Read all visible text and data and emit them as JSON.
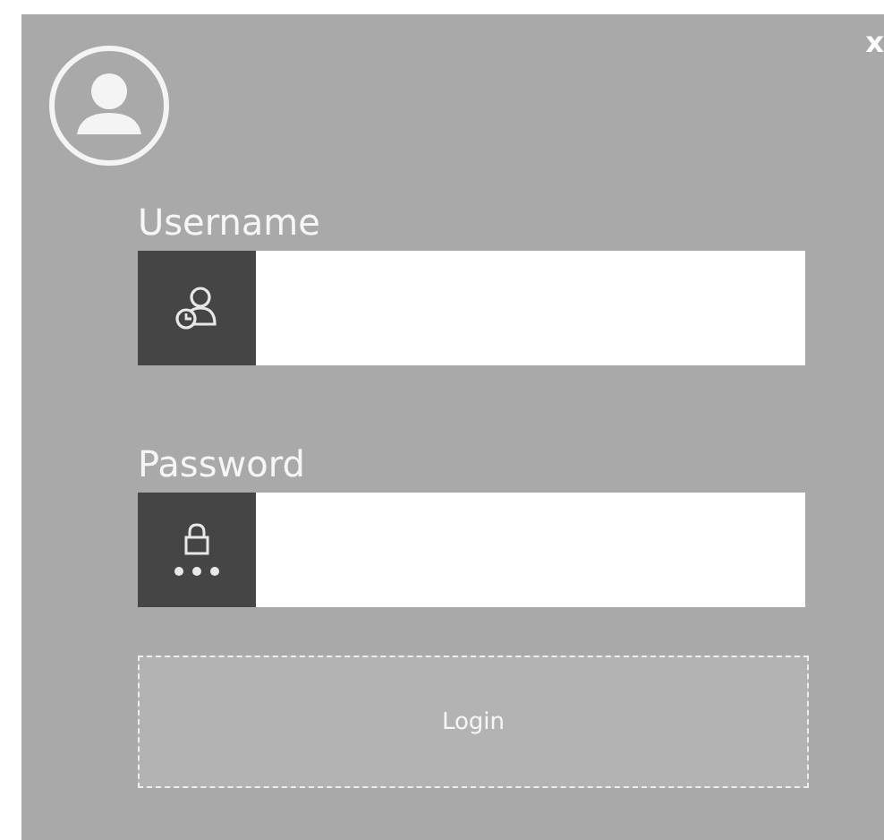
{
  "close": "x",
  "fields": [
    {
      "kind": "user",
      "label": "Username"
    },
    {
      "kind": "password",
      "label": "Password"
    }
  ],
  "login_button": "Login"
}
